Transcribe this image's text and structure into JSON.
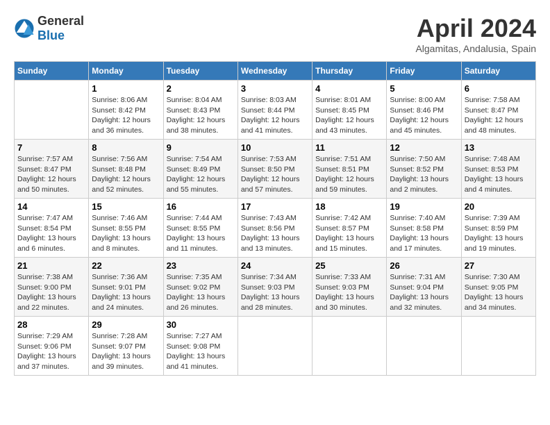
{
  "header": {
    "logo_general": "General",
    "logo_blue": "Blue",
    "month_title": "April 2024",
    "subtitle": "Algamitas, Andalusia, Spain"
  },
  "weekdays": [
    "Sunday",
    "Monday",
    "Tuesday",
    "Wednesday",
    "Thursday",
    "Friday",
    "Saturday"
  ],
  "rows": [
    [
      {
        "day": "",
        "info": ""
      },
      {
        "day": "1",
        "info": "Sunrise: 8:06 AM\nSunset: 8:42 PM\nDaylight: 12 hours\nand 36 minutes."
      },
      {
        "day": "2",
        "info": "Sunrise: 8:04 AM\nSunset: 8:43 PM\nDaylight: 12 hours\nand 38 minutes."
      },
      {
        "day": "3",
        "info": "Sunrise: 8:03 AM\nSunset: 8:44 PM\nDaylight: 12 hours\nand 41 minutes."
      },
      {
        "day": "4",
        "info": "Sunrise: 8:01 AM\nSunset: 8:45 PM\nDaylight: 12 hours\nand 43 minutes."
      },
      {
        "day": "5",
        "info": "Sunrise: 8:00 AM\nSunset: 8:46 PM\nDaylight: 12 hours\nand 45 minutes."
      },
      {
        "day": "6",
        "info": "Sunrise: 7:58 AM\nSunset: 8:47 PM\nDaylight: 12 hours\nand 48 minutes."
      }
    ],
    [
      {
        "day": "7",
        "info": "Sunrise: 7:57 AM\nSunset: 8:47 PM\nDaylight: 12 hours\nand 50 minutes."
      },
      {
        "day": "8",
        "info": "Sunrise: 7:56 AM\nSunset: 8:48 PM\nDaylight: 12 hours\nand 52 minutes."
      },
      {
        "day": "9",
        "info": "Sunrise: 7:54 AM\nSunset: 8:49 PM\nDaylight: 12 hours\nand 55 minutes."
      },
      {
        "day": "10",
        "info": "Sunrise: 7:53 AM\nSunset: 8:50 PM\nDaylight: 12 hours\nand 57 minutes."
      },
      {
        "day": "11",
        "info": "Sunrise: 7:51 AM\nSunset: 8:51 PM\nDaylight: 12 hours\nand 59 minutes."
      },
      {
        "day": "12",
        "info": "Sunrise: 7:50 AM\nSunset: 8:52 PM\nDaylight: 13 hours\nand 2 minutes."
      },
      {
        "day": "13",
        "info": "Sunrise: 7:48 AM\nSunset: 8:53 PM\nDaylight: 13 hours\nand 4 minutes."
      }
    ],
    [
      {
        "day": "14",
        "info": "Sunrise: 7:47 AM\nSunset: 8:54 PM\nDaylight: 13 hours\nand 6 minutes."
      },
      {
        "day": "15",
        "info": "Sunrise: 7:46 AM\nSunset: 8:55 PM\nDaylight: 13 hours\nand 8 minutes."
      },
      {
        "day": "16",
        "info": "Sunrise: 7:44 AM\nSunset: 8:55 PM\nDaylight: 13 hours\nand 11 minutes."
      },
      {
        "day": "17",
        "info": "Sunrise: 7:43 AM\nSunset: 8:56 PM\nDaylight: 13 hours\nand 13 minutes."
      },
      {
        "day": "18",
        "info": "Sunrise: 7:42 AM\nSunset: 8:57 PM\nDaylight: 13 hours\nand 15 minutes."
      },
      {
        "day": "19",
        "info": "Sunrise: 7:40 AM\nSunset: 8:58 PM\nDaylight: 13 hours\nand 17 minutes."
      },
      {
        "day": "20",
        "info": "Sunrise: 7:39 AM\nSunset: 8:59 PM\nDaylight: 13 hours\nand 19 minutes."
      }
    ],
    [
      {
        "day": "21",
        "info": "Sunrise: 7:38 AM\nSunset: 9:00 PM\nDaylight: 13 hours\nand 22 minutes."
      },
      {
        "day": "22",
        "info": "Sunrise: 7:36 AM\nSunset: 9:01 PM\nDaylight: 13 hours\nand 24 minutes."
      },
      {
        "day": "23",
        "info": "Sunrise: 7:35 AM\nSunset: 9:02 PM\nDaylight: 13 hours\nand 26 minutes."
      },
      {
        "day": "24",
        "info": "Sunrise: 7:34 AM\nSunset: 9:03 PM\nDaylight: 13 hours\nand 28 minutes."
      },
      {
        "day": "25",
        "info": "Sunrise: 7:33 AM\nSunset: 9:03 PM\nDaylight: 13 hours\nand 30 minutes."
      },
      {
        "day": "26",
        "info": "Sunrise: 7:31 AM\nSunset: 9:04 PM\nDaylight: 13 hours\nand 32 minutes."
      },
      {
        "day": "27",
        "info": "Sunrise: 7:30 AM\nSunset: 9:05 PM\nDaylight: 13 hours\nand 34 minutes."
      }
    ],
    [
      {
        "day": "28",
        "info": "Sunrise: 7:29 AM\nSunset: 9:06 PM\nDaylight: 13 hours\nand 37 minutes."
      },
      {
        "day": "29",
        "info": "Sunrise: 7:28 AM\nSunset: 9:07 PM\nDaylight: 13 hours\nand 39 minutes."
      },
      {
        "day": "30",
        "info": "Sunrise: 7:27 AM\nSunset: 9:08 PM\nDaylight: 13 hours\nand 41 minutes."
      },
      {
        "day": "",
        "info": ""
      },
      {
        "day": "",
        "info": ""
      },
      {
        "day": "",
        "info": ""
      },
      {
        "day": "",
        "info": ""
      }
    ]
  ]
}
